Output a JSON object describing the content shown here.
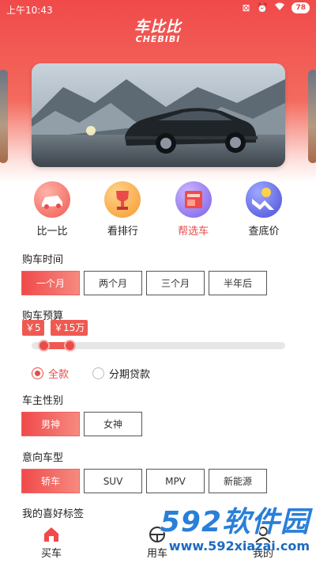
{
  "status_bar": {
    "time": "上午10:43",
    "battery": "78"
  },
  "logo": {
    "main": "车比比",
    "sub": "CHEBIBI"
  },
  "nav": [
    {
      "label": "比一比",
      "icon": "car-compare-icon",
      "color": "#f26a5e"
    },
    {
      "label": "看排行",
      "icon": "trophy-icon",
      "color": "#f7a23a"
    },
    {
      "label": "帮选车",
      "icon": "book-icon",
      "color": "#8a6cf0"
    },
    {
      "label": "查底价",
      "icon": "price-trend-icon",
      "color": "#5a5fe0"
    }
  ],
  "purchase_time": {
    "title": "购车时间",
    "options": [
      "一个月",
      "两个月",
      "三个月",
      "半年后"
    ],
    "selected": "一个月"
  },
  "budget": {
    "title": "购车预算",
    "min_label": "￥5",
    "max_label": "￥15万"
  },
  "payment": {
    "options": [
      "全款",
      "分期贷款"
    ],
    "selected": "全款"
  },
  "gender": {
    "title": "车主性别",
    "options": [
      "男神",
      "女神"
    ],
    "selected": "男神"
  },
  "car_type": {
    "title": "意向车型",
    "options": [
      "轿车",
      "SUV",
      "MPV",
      "新能源"
    ],
    "selected": "轿车"
  },
  "tags": {
    "title": "我的喜好标签"
  },
  "tabbar": {
    "tabs": [
      {
        "label": "买车"
      },
      {
        "label": "用车"
      },
      {
        "label": "我的"
      }
    ]
  },
  "watermark": {
    "main": "592软件园",
    "url": "www.592xiazai.com"
  }
}
